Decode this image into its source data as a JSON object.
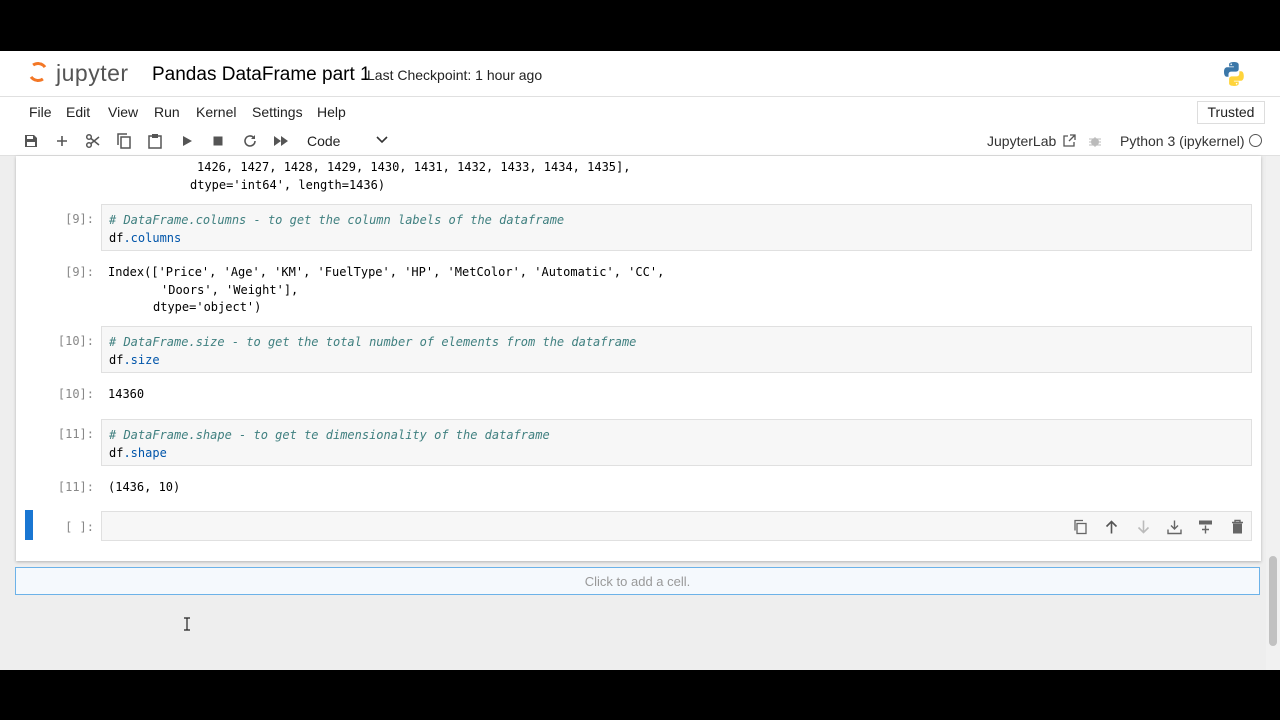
{
  "header": {
    "logo_text": "jupyter",
    "notebook_title": "Pandas DataFrame part 1",
    "checkpoint": "Last Checkpoint: 1 hour ago"
  },
  "menu": [
    "File",
    "Edit",
    "View",
    "Run",
    "Kernel",
    "Settings",
    "Help"
  ],
  "trusted": "Trusted",
  "toolbar": {
    "cell_type": "Code",
    "jupyterlab_label": "JupyterLab",
    "kernel_name": "Python 3 (ipykernel)"
  },
  "cells": {
    "prev_output": {
      "line1": "1426, 1427, 1428, 1429, 1430, 1431, 1432, 1433, 1434, 1435],",
      "line2": "dtype='int64', length=1436)"
    },
    "c9": {
      "in_prompt": "[9]:",
      "comment": "# DataFrame.columns - to get the column labels of the dataframe",
      "code_obj": "df",
      "code_attr": ".columns",
      "out_prompt": "[9]:",
      "out_line1": "Index(['Price', 'Age', 'KM', 'FuelType', 'HP', 'MetColor', 'Automatic', 'CC',",
      "out_line2": "'Doors', 'Weight'],",
      "out_line3": "dtype='object')"
    },
    "c10": {
      "in_prompt": "[10]:",
      "comment": "# DataFrame.size - to get the total number of elements from the dataframe",
      "code_obj": "df",
      "code_attr": ".size",
      "out_prompt": "[10]:",
      "out_line1": "14360"
    },
    "c11": {
      "in_prompt": "[11]:",
      "comment": "# DataFrame.shape - to get te dimensionality of the dataframe",
      "code_obj": "df",
      "code_attr": ".shape",
      "out_prompt": "[11]:",
      "out_line1": "(1436, 10)"
    },
    "empty": {
      "in_prompt": "[ ]:"
    }
  },
  "add_cell": "Click to add a cell.",
  "colors": {
    "accent": "#1976d2",
    "jupyter_orange": "#f37726",
    "comment": "#408080",
    "attribute": "#0055aa"
  },
  "icons": [
    "save-icon",
    "add-icon",
    "cut-icon",
    "copy-icon",
    "paste-icon",
    "run-icon",
    "stop-icon",
    "restart-icon",
    "run-all-icon",
    "chevron-down-icon",
    "external-link-icon",
    "bug-icon",
    "kernel-status-icon",
    "duplicate-cell-icon",
    "move-up-icon",
    "move-down-icon",
    "insert-below-icon",
    "insert-above-icon",
    "delete-icon",
    "python-logo-icon"
  ]
}
